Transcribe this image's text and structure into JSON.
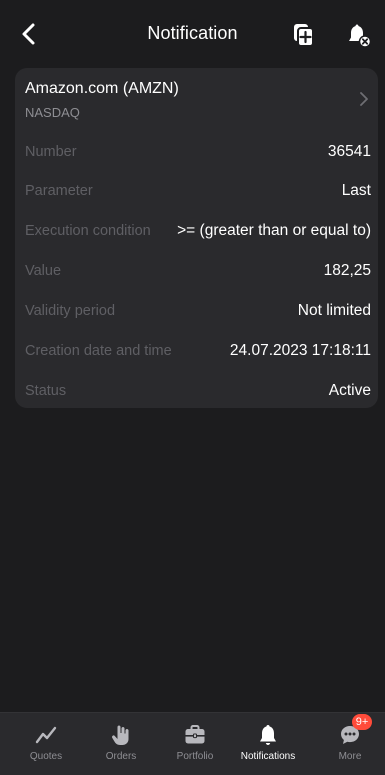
{
  "header": {
    "title": "Notification",
    "back_icon": "chevron-left-icon",
    "action_icons": [
      "copy-add-icon",
      "bell-delete-icon"
    ]
  },
  "instrument": {
    "name": "Amazon.com (AMZN)",
    "exchange": "NASDAQ"
  },
  "details": [
    {
      "label": "Number",
      "value": "36541"
    },
    {
      "label": "Parameter",
      "value": "Last"
    },
    {
      "label": "Execution condition",
      "value": ">= (greater than or equal to)"
    },
    {
      "label": "Value",
      "value": "182,25"
    },
    {
      "label": "Validity period",
      "value": "Not limited"
    },
    {
      "label": "Creation date and time",
      "value": "24.07.2023 17:18:11"
    },
    {
      "label": "Status",
      "value": "Active"
    }
  ],
  "tabbar": {
    "tabs": [
      {
        "label": "Quotes",
        "icon": "chart-line-icon"
      },
      {
        "label": "Orders",
        "icon": "hand-icon"
      },
      {
        "label": "Portfolio",
        "icon": "briefcase-icon"
      },
      {
        "label": "Notifications",
        "icon": "bell-icon",
        "active": true
      },
      {
        "label": "More",
        "icon": "more-dots-icon",
        "badge": "9+"
      }
    ]
  },
  "colors": {
    "background": "#1c1c1e",
    "card": "#2a2a2d",
    "label": "#5f5f64",
    "badge": "#ff4b3a"
  }
}
